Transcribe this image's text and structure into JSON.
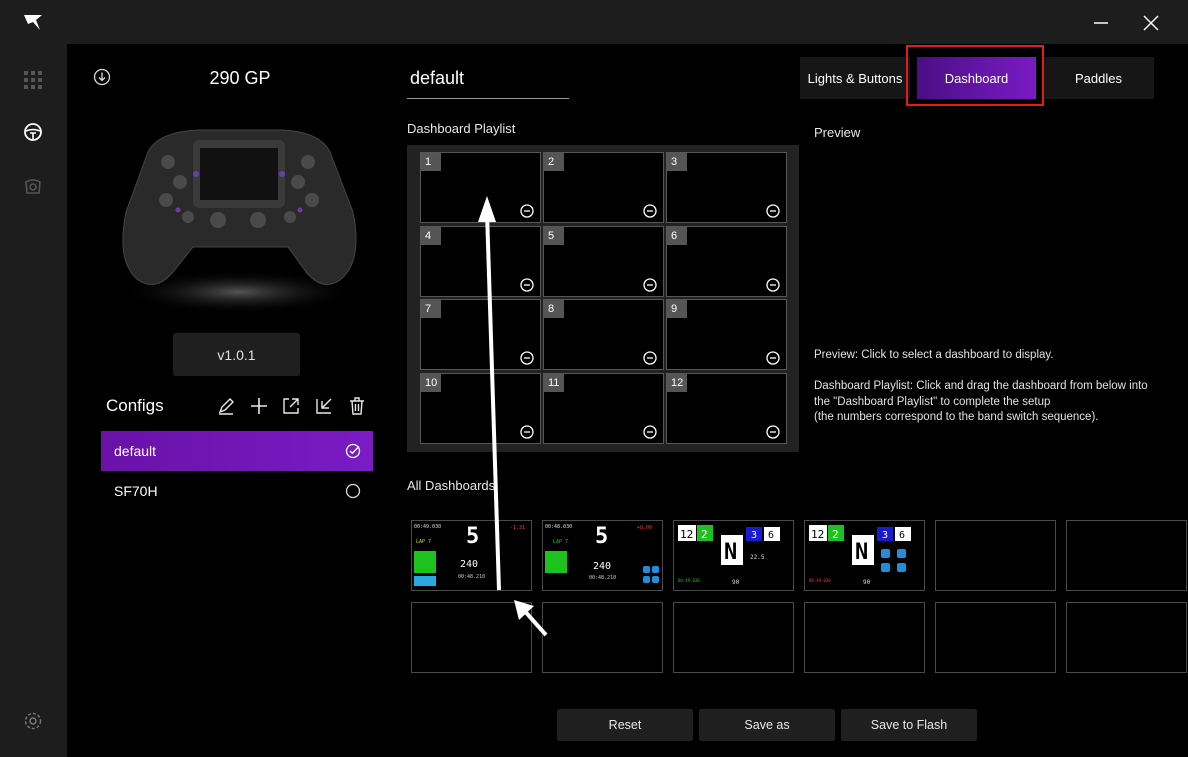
{
  "window": {
    "minimize_icon": "minimize-icon",
    "close_icon": "close-icon"
  },
  "rail": {
    "icons": [
      "logo-icon",
      "grid-icon",
      "steering-wheel-icon",
      "pedal-icon",
      "settings-icon"
    ]
  },
  "device": {
    "name": "290 GP",
    "firmware": "v1.0.1"
  },
  "configs": {
    "label": "Configs",
    "items": [
      {
        "name": "default",
        "selected": true
      },
      {
        "name": "SF70H",
        "selected": false
      }
    ]
  },
  "current_config": "default",
  "tabs": [
    {
      "label": "Lights & Buttons",
      "active": false
    },
    {
      "label": "Dashboard",
      "active": true
    },
    {
      "label": "Paddles",
      "active": false
    }
  ],
  "playlist": {
    "label": "Dashboard Playlist",
    "slots": [
      "1",
      "2",
      "3",
      "4",
      "5",
      "6",
      "7",
      "8",
      "9",
      "10",
      "11",
      "12"
    ]
  },
  "all_dashboards": {
    "label": "All Dashboards"
  },
  "dashboard_thumbnails": [
    {
      "gear": "5",
      "speed": "240",
      "time": "00:49.030",
      "delta": "-1.31",
      "lap": "LAP 7",
      "laptime": "00:48.210"
    },
    {
      "gear": "5",
      "speed": "240",
      "time": "00:48.030",
      "delta": "+8.00",
      "lap": "LAP 7",
      "laptime": "00:48.210"
    },
    {
      "pos": "12",
      "lap": "2",
      "gear": "N",
      "a": "3",
      "b": "6",
      "v1": "22.5",
      "v2": "90"
    },
    {
      "pos": "12",
      "lap": "2",
      "gear": "N",
      "a": "3",
      "b": "6",
      "v2": "90"
    }
  ],
  "preview": {
    "label": "Preview",
    "help1": "Preview: Click to select a dashboard to display.",
    "help2a": "Dashboard Playlist: Click and drag the dashboard from below into",
    "help2b": "the \"Dashboard Playlist\" to complete the setup",
    "help2c": "(the numbers correspond to the band switch sequence)."
  },
  "buttons": {
    "reset": "Reset",
    "save_as": "Save as",
    "save_flash": "Save to Flash"
  },
  "colors": {
    "accent": "#7a1bc4",
    "highlight": "#e41b1b"
  }
}
